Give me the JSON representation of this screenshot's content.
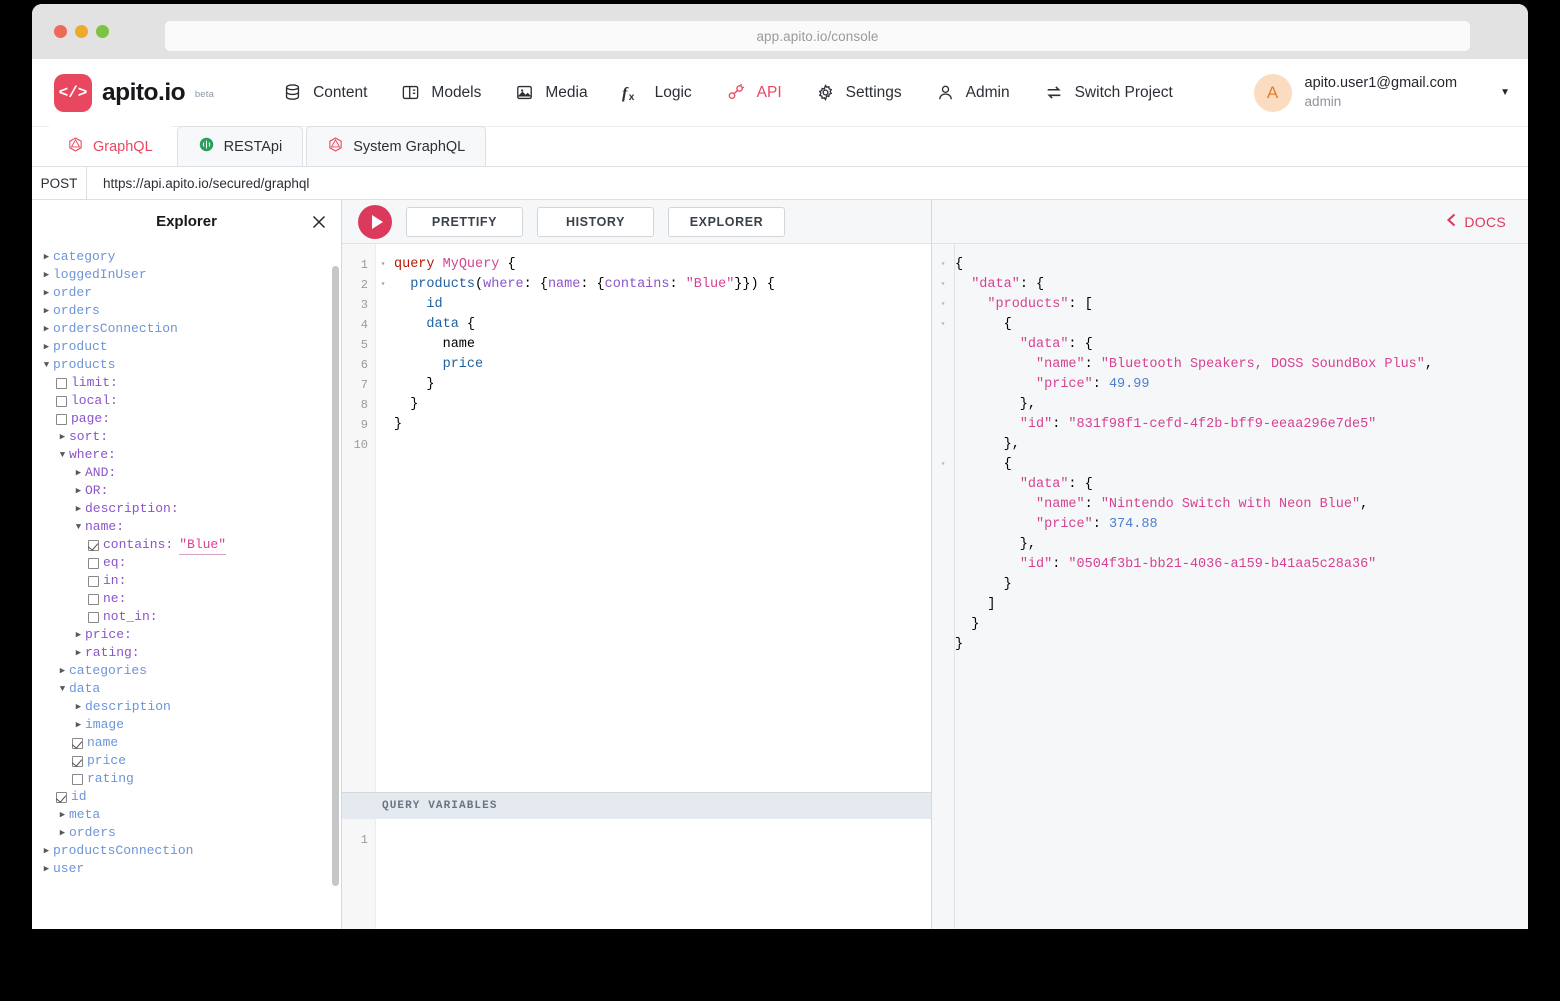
{
  "browser": {
    "url": "app.apito.io/console"
  },
  "header": {
    "logo_text": "apito.io",
    "logo_mark": "</>",
    "logo_badge": "beta",
    "nav": [
      {
        "label": "Content",
        "icon": "database-icon",
        "active": false
      },
      {
        "label": "Models",
        "icon": "models-panel-icon",
        "active": false
      },
      {
        "label": "Media",
        "icon": "image-icon",
        "active": false
      },
      {
        "label": "Logic",
        "icon": "function-fx-icon",
        "active": false
      },
      {
        "label": "API",
        "icon": "plug-connect-icon",
        "active": true
      },
      {
        "label": "Settings",
        "icon": "gear-icon",
        "active": false
      },
      {
        "label": "Admin",
        "icon": "user-icon",
        "active": false
      },
      {
        "label": "Switch Project",
        "icon": "swap-arrows-icon",
        "active": false
      }
    ],
    "account": {
      "avatar_initial": "A",
      "email": "apito.user1@gmail.com",
      "role": "admin",
      "caret": "▼"
    }
  },
  "tabs": [
    {
      "label": "GraphQL",
      "icon": "graphql-icon",
      "active": true
    },
    {
      "label": "RESTApi",
      "icon": "rest-api-icon",
      "active": false
    },
    {
      "label": "System GraphQL",
      "icon": "graphql-icon",
      "active": false
    }
  ],
  "request": {
    "method": "POST",
    "endpoint": "https://api.apito.io/secured/graphql"
  },
  "explorer": {
    "title": "Explorer",
    "close_icon": "close-icon",
    "tree": [
      {
        "indent": 0,
        "marker": "arrow-right",
        "kind": "field",
        "label": "category"
      },
      {
        "indent": 0,
        "marker": "arrow-right",
        "kind": "field",
        "label": "loggedInUser"
      },
      {
        "indent": 0,
        "marker": "arrow-right",
        "kind": "field",
        "label": "order"
      },
      {
        "indent": 0,
        "marker": "arrow-right",
        "kind": "field",
        "label": "orders"
      },
      {
        "indent": 0,
        "marker": "arrow-right",
        "kind": "field",
        "label": "ordersConnection"
      },
      {
        "indent": 0,
        "marker": "arrow-right",
        "kind": "field",
        "label": "product"
      },
      {
        "indent": 0,
        "marker": "arrow-down",
        "kind": "field",
        "label": "products"
      },
      {
        "indent": 1,
        "marker": "checkbox-off",
        "kind": "arg",
        "label": "limit:"
      },
      {
        "indent": 1,
        "marker": "checkbox-off",
        "kind": "arg",
        "label": "local:"
      },
      {
        "indent": 1,
        "marker": "checkbox-off",
        "kind": "arg",
        "label": "page:"
      },
      {
        "indent": 1,
        "marker": "arrow-right",
        "kind": "arg",
        "label": "sort:"
      },
      {
        "indent": 1,
        "marker": "arrow-down",
        "kind": "arg",
        "label": "where:"
      },
      {
        "indent": 2,
        "marker": "arrow-right",
        "kind": "arg",
        "label": "AND:"
      },
      {
        "indent": 2,
        "marker": "arrow-right",
        "kind": "arg",
        "label": "OR:"
      },
      {
        "indent": 2,
        "marker": "arrow-right",
        "kind": "arg",
        "label": "description:"
      },
      {
        "indent": 2,
        "marker": "arrow-down",
        "kind": "arg",
        "label": "name:"
      },
      {
        "indent": 3,
        "marker": "checkbox-on",
        "kind": "arg",
        "label": "contains:",
        "value": "\"Blue\""
      },
      {
        "indent": 3,
        "marker": "checkbox-off",
        "kind": "arg",
        "label": "eq:"
      },
      {
        "indent": 3,
        "marker": "checkbox-off",
        "kind": "arg",
        "label": "in:"
      },
      {
        "indent": 3,
        "marker": "checkbox-off",
        "kind": "arg",
        "label": "ne:"
      },
      {
        "indent": 3,
        "marker": "checkbox-off",
        "kind": "arg",
        "label": "not_in:"
      },
      {
        "indent": 2,
        "marker": "arrow-right",
        "kind": "arg",
        "label": "price:"
      },
      {
        "indent": 2,
        "marker": "arrow-right",
        "kind": "arg",
        "label": "rating:"
      },
      {
        "indent": 1,
        "marker": "arrow-right",
        "kind": "field",
        "label": "categories"
      },
      {
        "indent": 1,
        "marker": "arrow-down",
        "kind": "field",
        "label": "data"
      },
      {
        "indent": 2,
        "marker": "arrow-right",
        "kind": "field",
        "label": "description"
      },
      {
        "indent": 2,
        "marker": "arrow-right",
        "kind": "field",
        "label": "image"
      },
      {
        "indent": 2,
        "marker": "checkbox-on",
        "kind": "field",
        "label": "name"
      },
      {
        "indent": 2,
        "marker": "checkbox-on",
        "kind": "field",
        "label": "price"
      },
      {
        "indent": 2,
        "marker": "checkbox-off",
        "kind": "field",
        "label": "rating"
      },
      {
        "indent": 1,
        "marker": "checkbox-on",
        "kind": "field",
        "label": "id"
      },
      {
        "indent": 1,
        "marker": "arrow-right",
        "kind": "field",
        "label": "meta"
      },
      {
        "indent": 1,
        "marker": "arrow-right",
        "kind": "field",
        "label": "orders"
      },
      {
        "indent": 0,
        "marker": "arrow-right",
        "kind": "field",
        "label": "productsConnection"
      },
      {
        "indent": 0,
        "marker": "arrow-right",
        "kind": "field",
        "label": "user"
      }
    ]
  },
  "toolbar": {
    "run_icon": "play-icon",
    "prettify_label": "PRETTIFY",
    "history_label": "HISTORY",
    "explorer_label": "EXPLORER"
  },
  "query": {
    "line_numbers": [
      "1",
      "2",
      "3",
      "4",
      "5",
      "6",
      "7",
      "8",
      "9",
      "10"
    ],
    "fold_markers": [
      "▾",
      "▾",
      "",
      "",
      "",
      "",
      "",
      "",
      "",
      ""
    ],
    "lines": [
      "query MyQuery {",
      "  products(where: {name: {contains: \"Blue\"}}) {",
      "    id",
      "    data {",
      "      name",
      "      price",
      "    }",
      "  }",
      "}",
      ""
    ]
  },
  "query_variables": {
    "header_label": "QUERY VARIABLES",
    "line_numbers": [
      "1"
    ],
    "content": ""
  },
  "docs": {
    "label": "DOCS",
    "icon": "chevron-left-icon"
  },
  "response": {
    "fold_markers": [
      "▾",
      "▾",
      "▾",
      "▾",
      "",
      "",
      "",
      "",
      "",
      "",
      "▾",
      "",
      "",
      "",
      "",
      "",
      "",
      "",
      ""
    ],
    "lines": [
      "{",
      "  \"data\": {",
      "    \"products\": [",
      "      {",
      "        \"data\": {",
      "          \"name\": \"Bluetooth Speakers, DOSS SoundBox Plus\",",
      "          \"price\": 49.99",
      "        },",
      "        \"id\": \"831f98f1-cefd-4f2b-bff9-eeaa296e7de5\"",
      "      },",
      "      {",
      "        \"data\": {",
      "          \"name\": \"Nintendo Switch with Neon Blue\",",
      "          \"price\": 374.88",
      "        },",
      "        \"id\": \"0504f3b1-bb21-4036-a159-b41aa5c28a36\"",
      "      }",
      "    ]",
      "  }",
      "}"
    ],
    "products": [
      {
        "id": "831f98f1-cefd-4f2b-bff9-eeaa296e7de5",
        "name": "Bluetooth Speakers, DOSS SoundBox Plus",
        "price": 49.99
      },
      {
        "id": "0504f3b1-bb21-4036-a159-b41aa5c28a36",
        "name": "Nintendo Switch with Neon Blue",
        "price": 374.88
      }
    ]
  },
  "colors": {
    "accent": "#e8485f",
    "run_button": "#dc3a5c",
    "field": "#6e95d6",
    "arg": "#8b55c9",
    "string": "#d64292",
    "number": "#4f7fd1",
    "keyword": "#b11a04"
  }
}
